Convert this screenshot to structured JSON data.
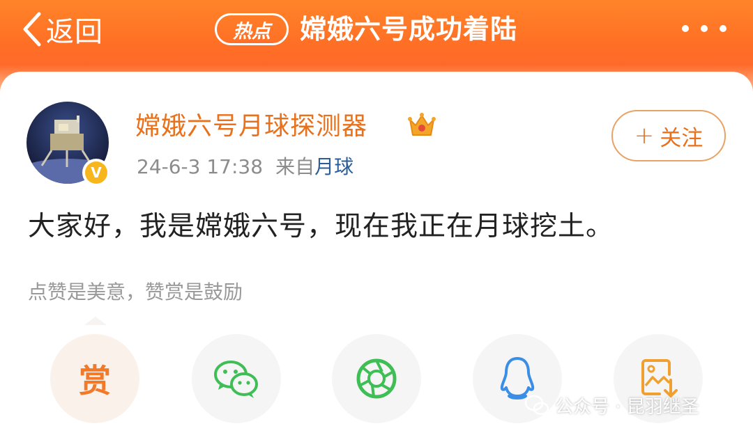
{
  "header": {
    "back_label": "返回",
    "hot_badge": "热点",
    "title": "嫦娥六号成功着陆"
  },
  "post": {
    "username": "嫦娥六号月球探测器",
    "timestamp": "24-6-3 17:38",
    "source_prefix": "来自",
    "source": "月球",
    "follow_label": "关注",
    "follow_icon": "+",
    "content": "大家好，我是嫦娥六号，现在我正在月球挖土。",
    "verified_mark": "V"
  },
  "tip": "点赞是美意，赞赏是鼓励",
  "share": {
    "reward_label": "赏"
  },
  "watermark": "公众号 · 昆羽继圣",
  "colors": {
    "accent": "#ff6e26",
    "username": "#e9711c",
    "link": "#2a5d9a",
    "wechat_green": "#3fbe56",
    "qq_blue": "#3a8ee6"
  },
  "icons": [
    "back-chevron-icon",
    "more-icon",
    "crown-icon",
    "verified-icon",
    "wechat-icon",
    "moments-icon",
    "qq-icon",
    "save-image-icon",
    "wechat-watermark-icon"
  ]
}
